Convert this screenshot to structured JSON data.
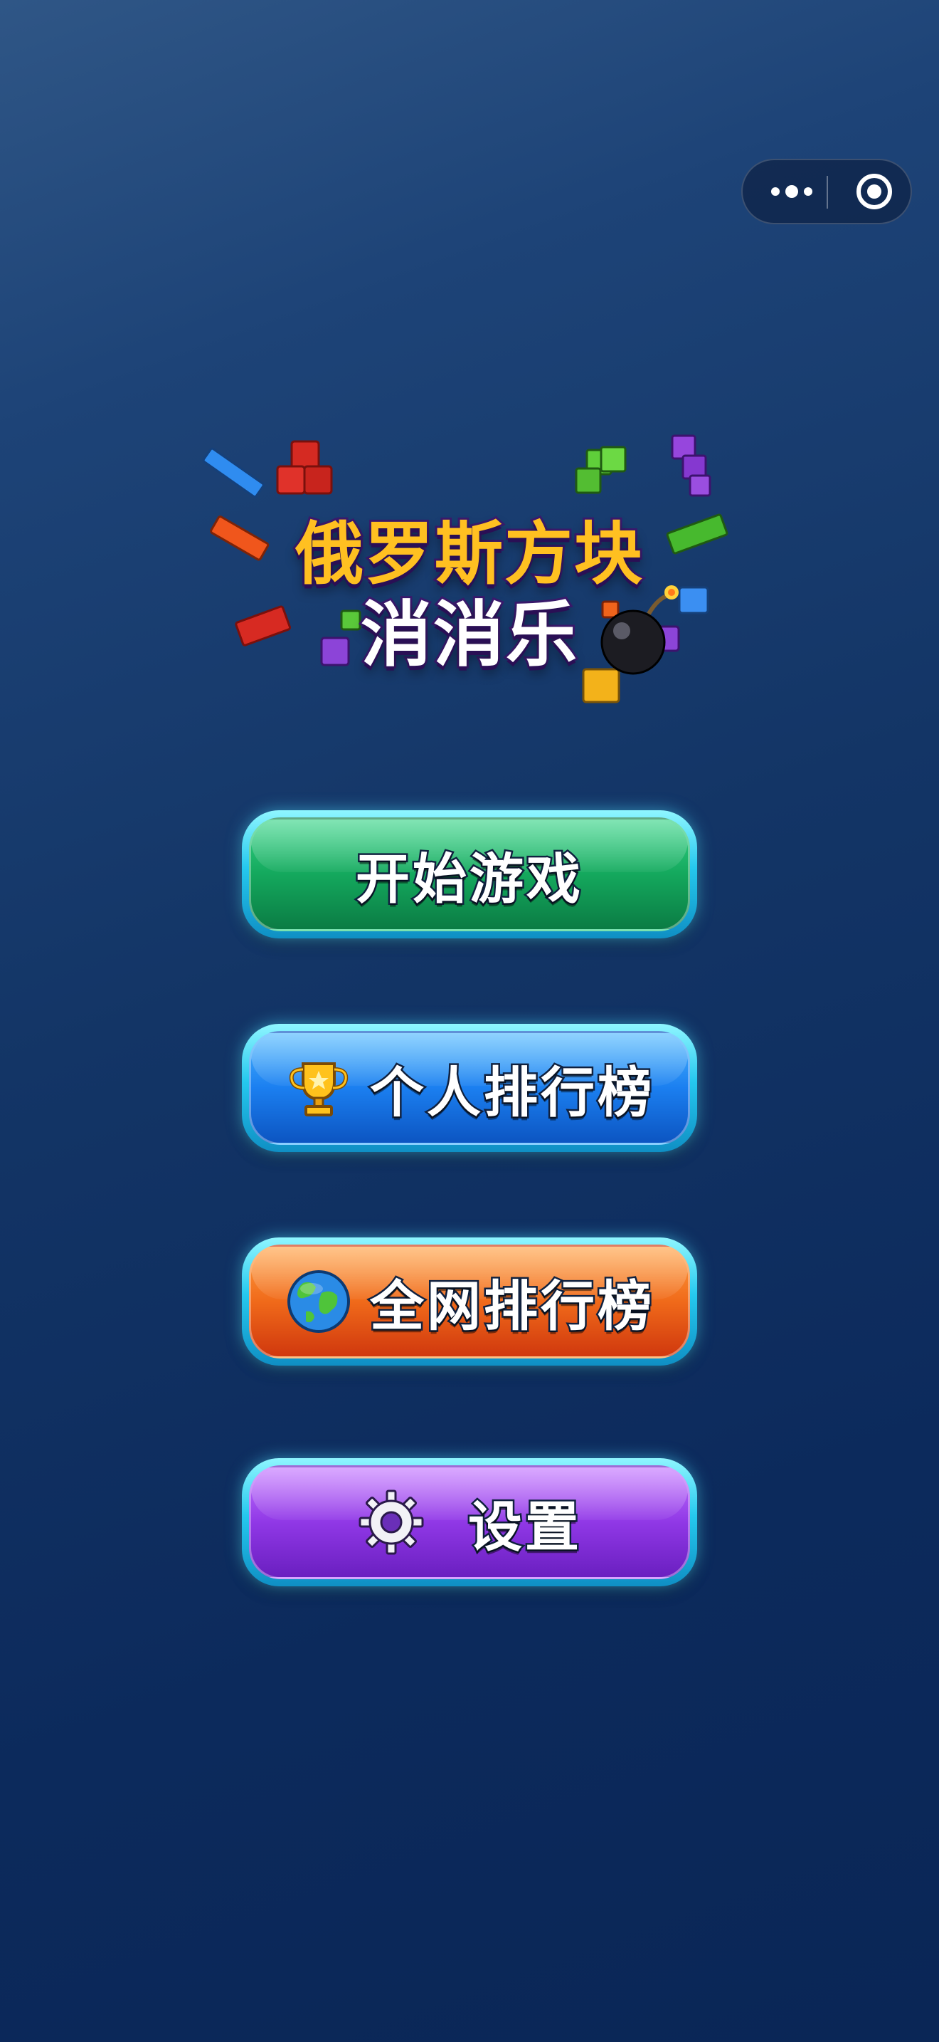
{
  "capsule": {
    "more_icon": "more-dots-icon",
    "close_icon": "target-close-icon"
  },
  "logo": {
    "line1": "俄罗斯方块",
    "line2": "消消乐"
  },
  "menu": {
    "start_label": "开始游戏",
    "personal_rank_label": "个人排行榜",
    "personal_rank_icon": "trophy-icon",
    "global_rank_label": "全网排行榜",
    "global_rank_icon": "globe-icon",
    "settings_label": "设置",
    "settings_icon": "gear-icon"
  },
  "colors": {
    "start": "#14a85d",
    "personal_rank": "#1b7ff0",
    "global_rank": "#f06a1a",
    "settings": "#9038e6",
    "button_rim": "#25c8ee"
  }
}
